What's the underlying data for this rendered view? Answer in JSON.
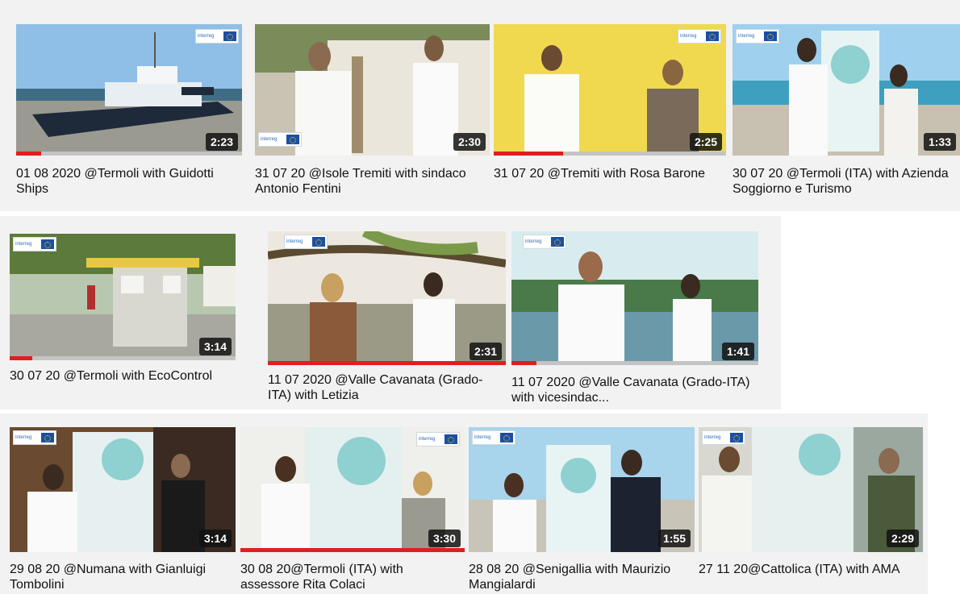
{
  "videos": [
    {
      "title": "01 08 2020 @Termoli with Guidotti Ships",
      "duration": "2:23",
      "watched": 0.11,
      "logo": "interreg-italy-croatia-logo"
    },
    {
      "title": "31 07 20 @Isole Tremiti with sindaco Antonio Fentini",
      "duration": "2:30",
      "watched": 0,
      "logo": "interreg-italy-croatia-logo"
    },
    {
      "title": "31 07 20 @Tremiti with Rosa Barone",
      "duration": "2:25",
      "watched": 0.3,
      "logo": "interreg-italy-croatia-logo"
    },
    {
      "title": "30 07 20 @Termoli (ITA) with Azienda Soggiorno e Turismo",
      "duration": "1:33",
      "watched": 0,
      "logo": "interreg-italy-croatia-logo"
    },
    {
      "title": "30 07 20 @Termoli with EcoControl",
      "duration": "3:14",
      "watched": 0.1,
      "logo": "interreg-italy-croatia-logo"
    },
    {
      "title": "11 07 2020 @Valle Cavanata (Grado-ITA) with Letizia",
      "duration": "2:31",
      "watched": 1.0,
      "logo": "interreg-italy-croatia-logo"
    },
    {
      "title": "11 07 2020 @Valle Cavanata (Grado-ITA) with vicesindac...",
      "duration": "1:41",
      "watched": 0.1,
      "logo": "interreg-italy-croatia-logo"
    },
    {
      "title": "29 08 20 @Numana with Gianluigi Tombolini",
      "duration": "3:14",
      "watched": 0,
      "logo": "interreg-italy-croatia-logo"
    },
    {
      "title": "30 08 20@Termoli (ITA) with assessore Rita Colaci",
      "duration": "3:30",
      "watched": 1.0,
      "logo": "interreg-italy-croatia-logo"
    },
    {
      "title": "28 08 20 @Senigallia with Maurizio Mangialardi",
      "duration": "1:55",
      "watched": 0,
      "logo": "interreg-italy-croatia-logo"
    },
    {
      "title": "27 11 20@Cattolica (ITA) with AMA",
      "duration": "2:29",
      "watched": 0,
      "logo": "interreg-italy-croatia-logo"
    }
  ],
  "colors": {
    "progress": "#e01e1e",
    "track": "#c4c4c4",
    "strip": "#f2f2f2"
  }
}
